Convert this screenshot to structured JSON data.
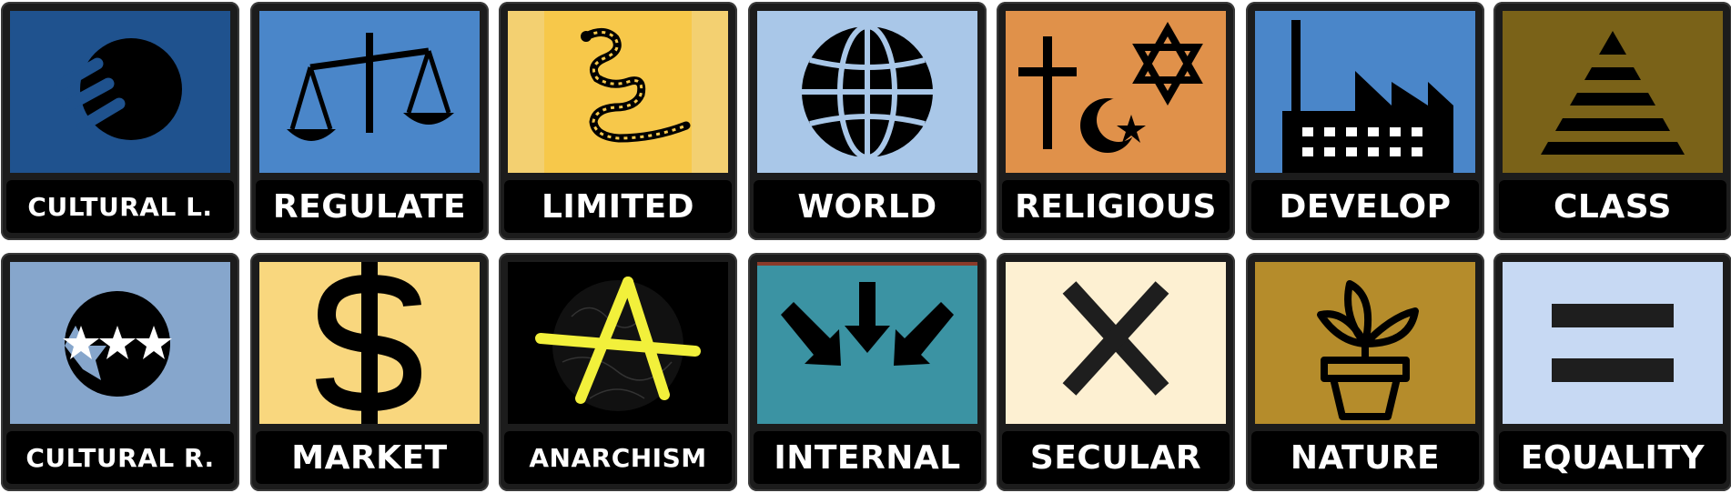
{
  "tiles": [
    {
      "label": "CULTURAL L.",
      "icon": "orb-icon",
      "color": "#1f528e"
    },
    {
      "label": "REGULATE",
      "icon": "scales-icon",
      "color": "#4a86c9"
    },
    {
      "label": "LIMITED",
      "icon": "gadsden-snake-icon",
      "color": "#f7c84a"
    },
    {
      "label": "WORLD",
      "icon": "globe-icon",
      "color": "#a9c7e8"
    },
    {
      "label": "RELIGIOUS",
      "icon": "religious-symbols-icon",
      "color": "#e0914a"
    },
    {
      "label": "DEVELOP",
      "icon": "factory-icon",
      "color": "#4a86c9"
    },
    {
      "label": "CLASS",
      "icon": "pyramid-icon",
      "color": "#7a6218"
    },
    {
      "label": "CULTURAL R.",
      "icon": "starred-orb-icon",
      "color": "#86a6cc"
    },
    {
      "label": "MARKET",
      "icon": "dollar-icon",
      "color": "#f9d77e"
    },
    {
      "label": "ANARCHISM",
      "icon": "anarchy-icon",
      "color": "#000000"
    },
    {
      "label": "INTERNAL",
      "icon": "inward-arrows-icon",
      "color": "#3b93a3"
    },
    {
      "label": "SECULAR",
      "icon": "cross-x-icon",
      "color": "#fdf0d2"
    },
    {
      "label": "NATURE",
      "icon": "potted-plant-icon",
      "color": "#b58c2b"
    },
    {
      "label": "EQUALITY",
      "icon": "equals-icon",
      "color": "#c7d9f3"
    }
  ]
}
